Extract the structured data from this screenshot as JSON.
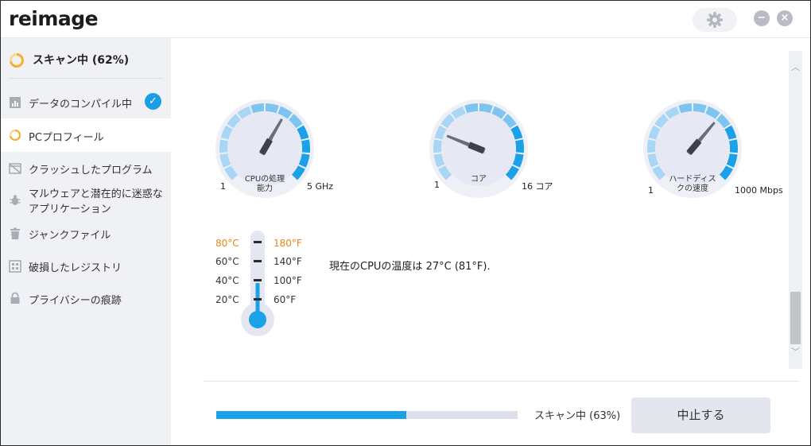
{
  "app": {
    "logo": "reimage"
  },
  "icons": {
    "settings": "gear-icon",
    "minimize": "minimize-icon",
    "close": "close-icon"
  },
  "window_controls": {
    "minimize_glyph": "−",
    "close_glyph": "×"
  },
  "sidebar": {
    "header": "スキャン中 (62%)",
    "items": [
      {
        "label": "データのコンパイル中",
        "icon": "chart-icon",
        "done": true
      },
      {
        "label": "PCプロフィール",
        "icon": "spinner-icon",
        "active": true
      },
      {
        "label": "クラッシュしたプログラム",
        "icon": "crashed-window-icon"
      },
      {
        "label": "マルウェアと潜在的に迷惑な",
        "label2": "アプリケーション",
        "icon": "bug-icon"
      },
      {
        "label": "ジャンクファイル",
        "icon": "trash-icon"
      },
      {
        "label": "破損したレジストリ",
        "icon": "registry-icon"
      },
      {
        "label": "プライバシーの痕跡",
        "icon": "lock-icon"
      }
    ],
    "check_glyph": "✓"
  },
  "gauges": [
    {
      "label1": "CPUの処理",
      "label2": "能力",
      "min": "1",
      "max": "5 GHz"
    },
    {
      "label1": "コア",
      "label2": "",
      "min": "1",
      "max": "16 コア"
    },
    {
      "label1": "ハードディス",
      "label2": "クの速度",
      "min": "1",
      "max": "1000 Mbps"
    }
  ],
  "thermometer": {
    "celsius": [
      "80°C",
      "60°C",
      "40°C",
      "20°C"
    ],
    "fahrenheit": [
      "180°F",
      "140°F",
      "100°F",
      "60°F"
    ]
  },
  "temperature_text": "現在のCPUの温度は 27°C (81°F).",
  "progress": {
    "value": 0.63,
    "label": "スキャン中 (63%)"
  },
  "stop_button": "中止する",
  "colors": {
    "accent": "#1aa1e8",
    "gauge_light": "#a9d6f5",
    "spinner": "#f5b02e",
    "hot": "#e8851a"
  }
}
